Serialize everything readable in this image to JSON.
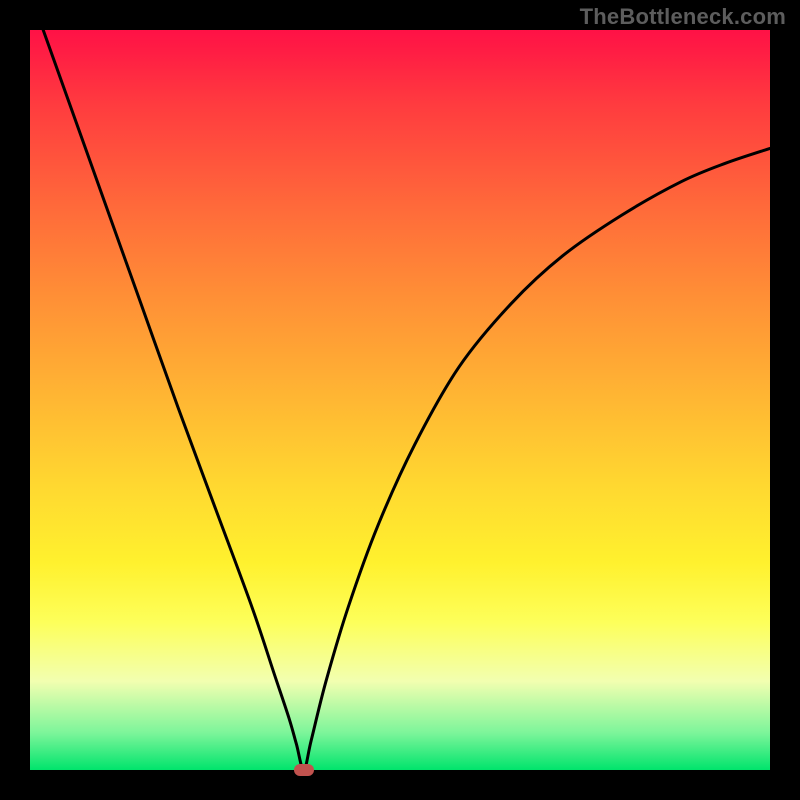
{
  "watermark": "TheBottleneck.com",
  "colors": {
    "gradient_top": "#ff1146",
    "gradient_bottom": "#00e46c",
    "curve": "#000000",
    "marker": "#c1524e",
    "frame": "#000000"
  },
  "chart_data": {
    "type": "line",
    "title": "",
    "xlabel": "",
    "ylabel": "",
    "xlim": [
      0,
      100
    ],
    "ylim": [
      0,
      100
    ],
    "grid": false,
    "x_min": 37,
    "marker": {
      "x": 37,
      "y": 0,
      "shape": "rounded-rect"
    },
    "series": [
      {
        "name": "bottleneck-curve",
        "x": [
          0,
          5,
          10,
          15,
          20,
          25,
          30,
          33,
          35,
          36,
          37,
          38,
          40,
          43,
          47,
          52,
          58,
          65,
          72,
          80,
          88,
          94,
          100
        ],
        "values": [
          105,
          91,
          77,
          63,
          49,
          35.5,
          22,
          13,
          7,
          3.5,
          0,
          4,
          12,
          22,
          33,
          44,
          54.5,
          63,
          69.5,
          75,
          79.5,
          82,
          84
        ]
      }
    ]
  }
}
